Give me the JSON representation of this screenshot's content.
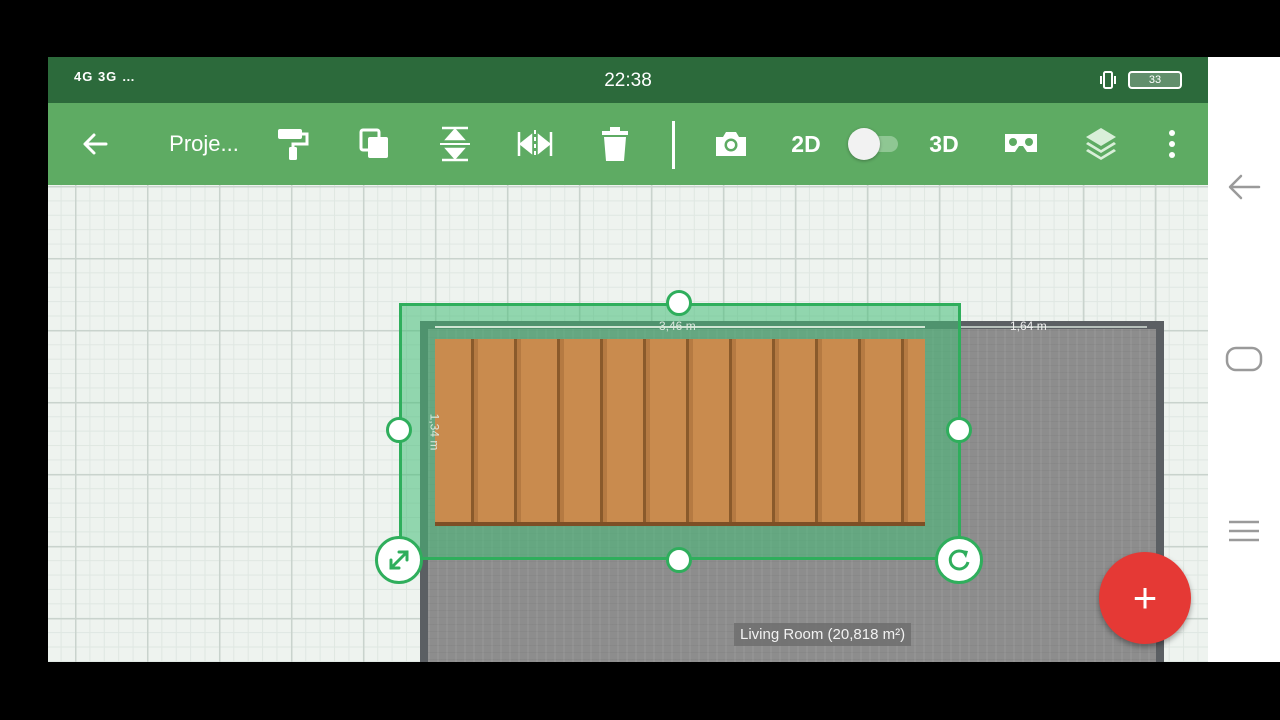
{
  "status_bar": {
    "signal_text": "4G 3G …",
    "time": "22:38",
    "battery": "33"
  },
  "toolbar": {
    "back_icon": "arrow-left-icon",
    "project_title": "Proje...",
    "tools": [
      "paint-roller-icon",
      "copy-icon",
      "flip-vertical-icon",
      "flip-horizontal-icon",
      "trash-icon",
      "camera-icon",
      "vr-headset-icon",
      "layers-icon",
      "more-vert-icon"
    ],
    "label_2d": "2D",
    "label_3d": "3D",
    "mode_toggle_on": false
  },
  "canvas": {
    "dimension_width": "3,46 m",
    "dimension_height": "1,34 m",
    "dimension_right": "1,64 m",
    "room_label": "Living Room (20,818 m²)"
  },
  "fab": {
    "label": "+"
  },
  "nav": {
    "icons": [
      "nav-back-icon",
      "nav-home-icon",
      "nav-menu-icon"
    ]
  },
  "colors": {
    "status_bar": "#2c6a3b",
    "toolbar": "#5eab63",
    "selection": "#2fae5c",
    "fab": "#e53935",
    "furniture": "#c98b4e"
  }
}
